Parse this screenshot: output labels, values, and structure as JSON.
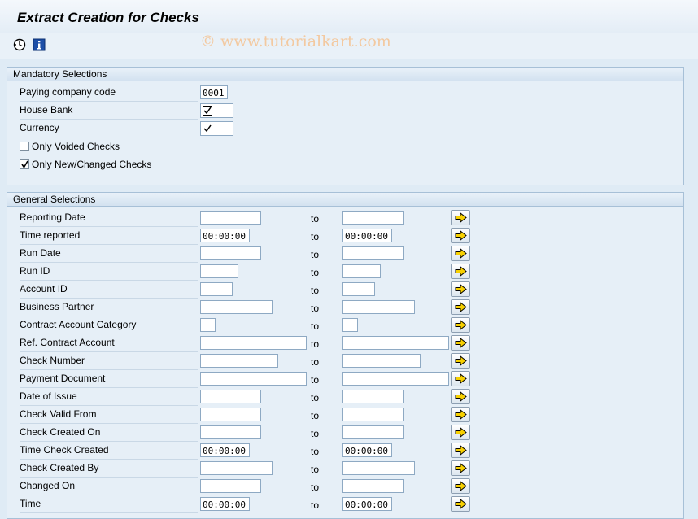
{
  "window": {
    "title": "Extract Creation for Checks"
  },
  "watermark": "© www.tutorialkart.com",
  "toolbar": {
    "execute_icon": "execute-clock-icon",
    "info_icon": "info-icon"
  },
  "mandatory": {
    "header": "Mandatory Selections",
    "paying_company_code": {
      "label": "Paying company code",
      "value": "0001"
    },
    "house_bank": {
      "label": "House Bank"
    },
    "currency": {
      "label": "Currency"
    },
    "only_voided": {
      "label": "Only Voided Checks",
      "checked": false
    },
    "only_new_changed": {
      "label": "Only New/Changed Checks",
      "checked": true
    }
  },
  "general": {
    "header": "General Selections",
    "to_label": "to",
    "rows": [
      {
        "label": "Reporting Date",
        "from": "",
        "to": ""
      },
      {
        "label": "Time reported",
        "from": "00:00:00",
        "to": "00:00:00"
      },
      {
        "label": "Run Date",
        "from": "",
        "to": ""
      },
      {
        "label": "Run ID",
        "from": "",
        "to": ""
      },
      {
        "label": "Account ID",
        "from": "",
        "to": ""
      },
      {
        "label": "Business Partner",
        "from": "",
        "to": ""
      },
      {
        "label": "Contract Account Category",
        "from": "",
        "to": ""
      },
      {
        "label": "Ref. Contract Account",
        "from": "",
        "to": ""
      },
      {
        "label": "Check Number",
        "from": "",
        "to": ""
      },
      {
        "label": "Payment Document",
        "from": "",
        "to": ""
      },
      {
        "label": "Date of Issue",
        "from": "",
        "to": ""
      },
      {
        "label": "Check Valid From",
        "from": "",
        "to": ""
      },
      {
        "label": "Check Created On",
        "from": "",
        "to": ""
      },
      {
        "label": "Time Check Created",
        "from": "00:00:00",
        "to": "00:00:00"
      },
      {
        "label": "Check Created By",
        "from": "",
        "to": ""
      },
      {
        "label": "Changed On",
        "from": "",
        "to": ""
      },
      {
        "label": "Time",
        "from": "00:00:00",
        "to": "00:00:00"
      }
    ]
  }
}
